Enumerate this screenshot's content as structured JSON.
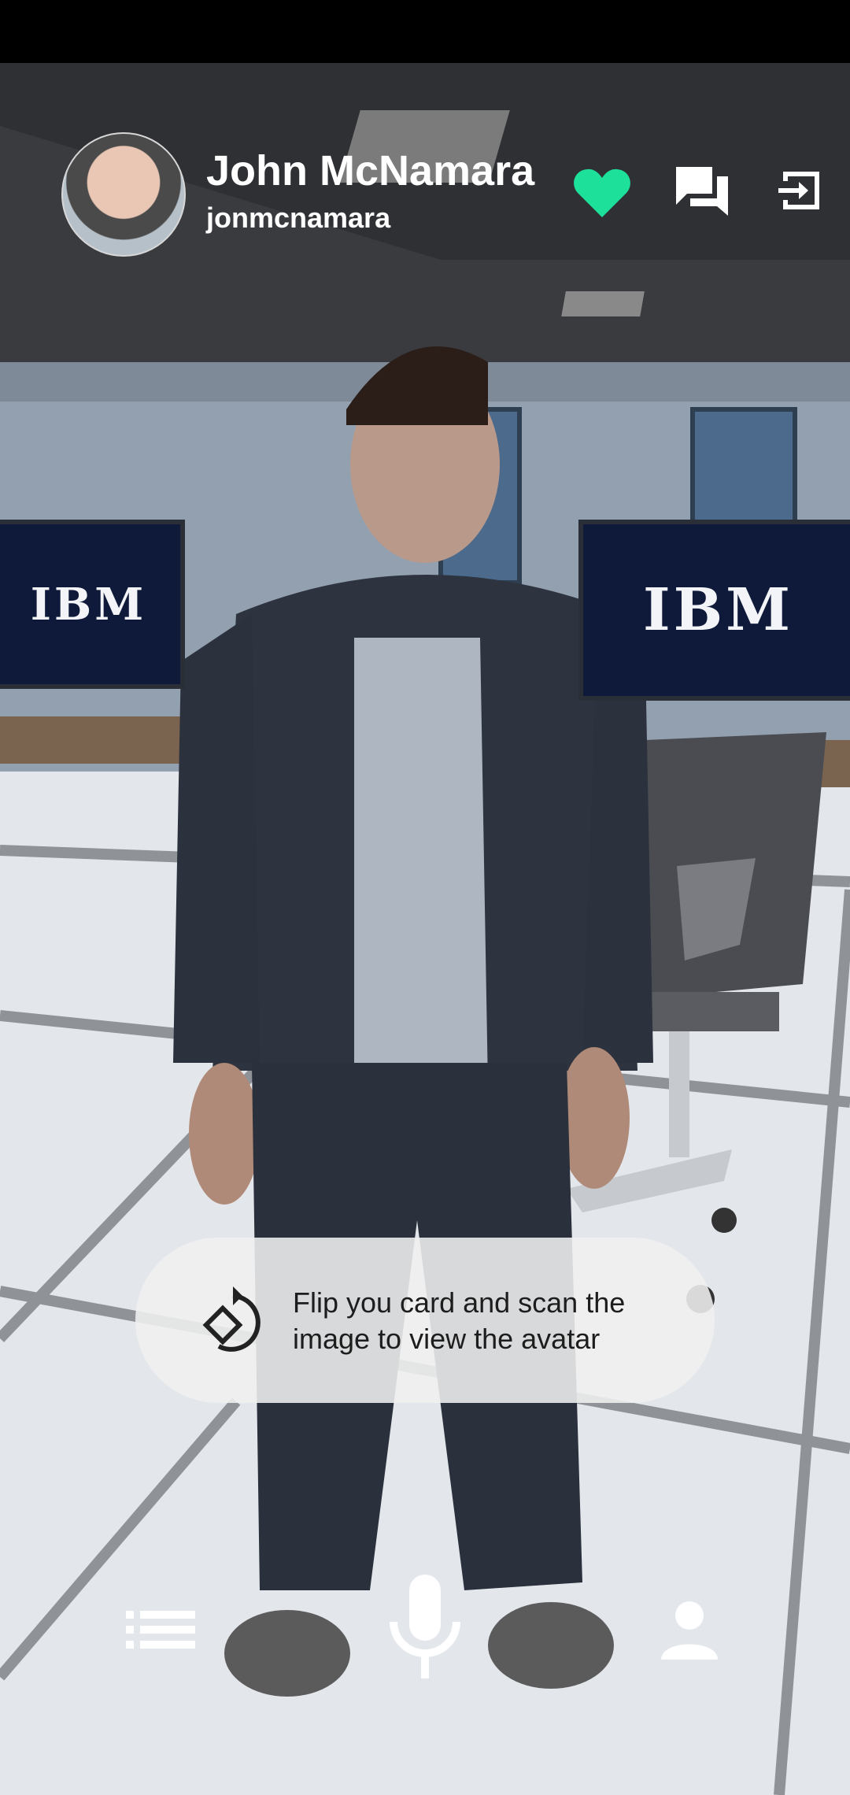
{
  "header": {
    "name": "John McNamara",
    "username": "jonmcnamara",
    "favorite_icon": "heart-icon",
    "favorite_color": "#1de09a",
    "chat_icon": "chat-icon",
    "logout_icon": "logout-icon"
  },
  "scene": {
    "monitor_label": "IBM"
  },
  "toast": {
    "icon": "flip-rotate-icon",
    "message": "Flip you card and scan the image to view the avatar"
  },
  "bottom_nav": {
    "list_icon": "list-icon",
    "mic_icon": "microphone-icon",
    "profile_icon": "person-icon"
  }
}
